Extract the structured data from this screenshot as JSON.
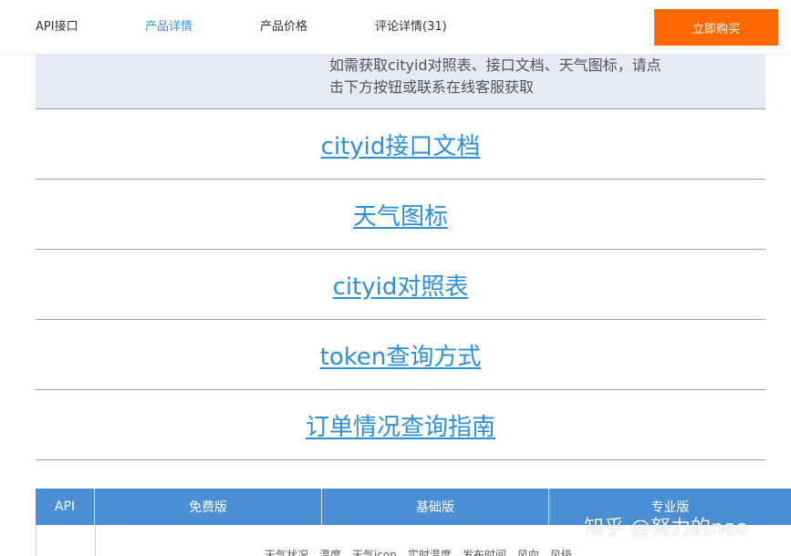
{
  "nav": {
    "tabs": [
      {
        "label": "API接口"
      },
      {
        "label": "产品详情",
        "active": true
      },
      {
        "label": "产品价格"
      },
      {
        "label": "评论详情(31)"
      }
    ],
    "buy_label": "立即购买"
  },
  "notice": {
    "line1": "如需获取cityid对照表、接口文档、天气图标，请点",
    "line2": "击下方按钮或联系在线客服获取"
  },
  "links": [
    {
      "label": "cityid接口文档"
    },
    {
      "label": "天气图标"
    },
    {
      "label": "cityid对照表"
    },
    {
      "label": "token查询方式"
    },
    {
      "label": "订单情况查询指南"
    }
  ],
  "table": {
    "headers": [
      "API",
      "免费版",
      "基础版",
      "专业版"
    ],
    "row_text": "天气状况、温度、天气icon、实时温度、发布时间、风向、风级"
  },
  "watermark": "知乎 @努力的neo",
  "colors": {
    "accent": "#2e9ad8",
    "buy_button": "#ff6a00",
    "link": "#2e8fdc",
    "table_header": "#4a8fd5",
    "notice_bg": "#e7e9f4"
  }
}
